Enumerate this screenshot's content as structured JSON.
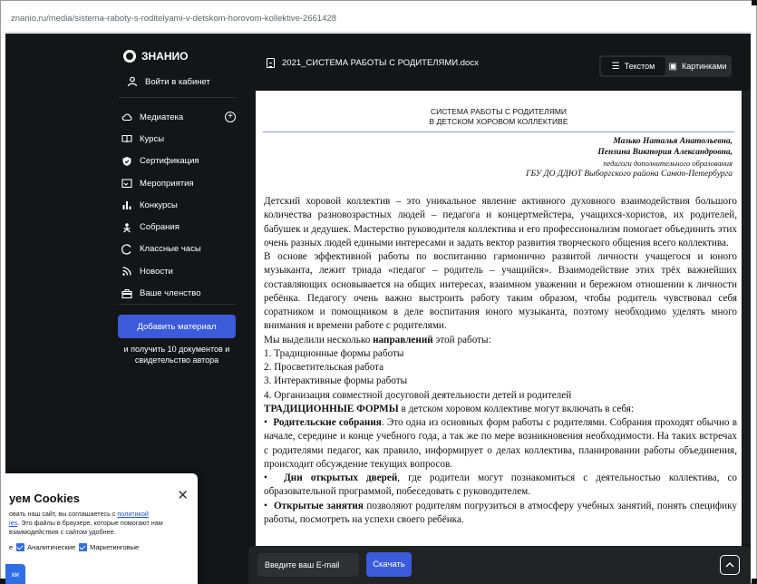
{
  "browser": {
    "url": "znanio.ru/media/sistema-raboty-s-roditelyami-v-detskom-horovom-kollektive-2661428"
  },
  "sidebar": {
    "logo": "ЗНАНИО",
    "cabinet": "Войти в кабинет",
    "items": [
      {
        "label": "Медиатека",
        "icon": "cloud-icon"
      },
      {
        "label": "Курсы",
        "icon": "book-icon"
      },
      {
        "label": "Сертификация",
        "icon": "shield-icon"
      },
      {
        "label": "Мероприятия",
        "icon": "event-icon"
      },
      {
        "label": "Конкурсы",
        "icon": "chart-icon"
      },
      {
        "label": "Собрания",
        "icon": "meeting-icon"
      },
      {
        "label": "Классные часы",
        "icon": "clock-icon"
      },
      {
        "label": "Новости",
        "icon": "rss-icon"
      },
      {
        "label": "Ваше членство",
        "icon": "membership-icon"
      }
    ],
    "add_button": "Добавить материал",
    "add_note": "и получить 10 документов и свидетельство автора"
  },
  "cookie": {
    "title": "уем Cookies",
    "text_before": "овать наш сайт, вы соглашаетесь с ",
    "link": "политикой",
    "link2": "ies",
    "text_after": ". Это файлы в браузере, которые помогают нам взаимодействия с сайтом удобнее.",
    "check_prefix": "е",
    "check1": "Аналитические",
    "check2": "Маркетинговые",
    "button": "ки"
  },
  "doc": {
    "filename": "2021_СИСТЕМА РАБОТЫ С РОДИТЕЛЯМИ.docx",
    "view_text": "Текстом",
    "view_images": "Картинками",
    "title1": "СИСТЕМА РАБОТЫ С РОДИТЕЛЯМИ",
    "title2": "В ДЕТСКОМ ХОРОВОМ КОЛЛЕКТИВЕ",
    "author1": "Мазько Наталья Анатольевна,",
    "author2": "Пензина Виктория Александровна,",
    "role": "педагоги дополнительного образования",
    "org": "ГБУ ДО ДДЮТ Выборгского района Санкт-Петербурга",
    "p1": "Детский хоровой коллектив – это уникальное явление активного духовного взаимодействия большого количества разновозрастных людей – педагога и концертмейстера, учащихся-хористов, их родителей, бабушек и дедушек. Мастерство руководителя коллектива и его профессионализм помогает объединить этих очень разных людей едиными интересами и задать вектор развития творческого общения всего коллектива.",
    "p2": "В основе эффективной работы по воспитанию гармонично развитой личности учащегося и юного музыканта, лежит триада «педагог – родитель – учащийся». Взаимодействие этих трёх важнейших составляющих основывается на общих интересах, взаимном уважении и бережном отношении к личности ребёнка. Педагогу очень важно выстроить работу таким образом, чтобы родитель чувствовал себя соратником и помощником в деле воспитания юного музыканта, поэтому необходимо уделять много внимания и времени работе с родителями.",
    "p3_a": "Мы выделили несколько ",
    "p3_b": "направлений",
    "p3_c": " этой работы:",
    "list1": "1. Традиционные формы работы",
    "list2": "2. Просветительская работа",
    "list3": "3. Интерактивные формы работы",
    "list4": "4. Организация совместной досуговой деятельности детей и родителей",
    "p4_a": "ТРАДИЦИОННЫЕ ФОРМЫ",
    "p4_b": " в детском хоровом коллективе могут включать в себя:",
    "b1_a": "Родительские собрания",
    "b1_b": ". Это одна из основных форм работы с родителями. Собрания проходят обычно в начале, середине и конце учебного года, а так же по мере возникновения необходимости. На таких встречах с родителями педагог, как правило, информирует о делах коллектива, планировании работы объединения, происходит обсуждение текущих вопросов.",
    "b2_a": "Дни открытых дверей",
    "b2_b": ", где родители могут познакомиться с деятельностью коллектива, со образовательной программой, побеседовать с руководителем.",
    "b3_a": "Открытые занятия",
    "b3_b": " позволяют родителям погрузиться в атмосферу учебных занятий, понять специфику работы, посмотреть на успехи своего ребёнка."
  },
  "bottom": {
    "email_placeholder": "Введите ваш E-mail",
    "download": "Скачать"
  }
}
